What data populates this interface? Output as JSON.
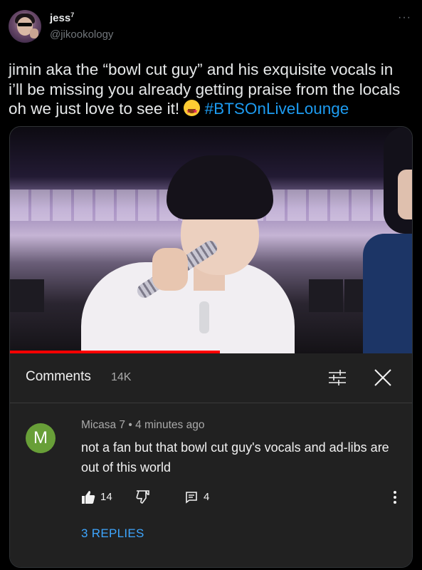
{
  "tweet": {
    "author_name": "jess",
    "author_superscript": "7",
    "author_handle": "@jikookology",
    "more_icon": "more-horizontal-icon",
    "text_line1": "jimin aka the “bowl cut guy” and his exquisite vocals in",
    "text_line2": "i’ll be missing you already getting praise from the locals",
    "text_line3": "oh we just love to see it! ",
    "emoji": "star-struck-emoji",
    "hashtag": "#BTSOnLiveLounge"
  },
  "video": {
    "progress": 0.52,
    "progress_color": "#ff0000"
  },
  "comments_panel": {
    "title": "Comments",
    "count": "14K",
    "filter_icon": "filter-sliders-icon",
    "close_icon": "close-icon",
    "background": "#212121"
  },
  "comment": {
    "avatar_letter": "M",
    "avatar_color": "#689f38",
    "author": "Micasa 7",
    "separator": "•",
    "time": "4 minutes ago",
    "text": "not a fan but that bowl cut guy's vocals and ad-libs are out of this world",
    "like_count": "14",
    "reply_count": "4",
    "replies_label": "3 REPLIES",
    "link_color": "#3ea6ff"
  }
}
